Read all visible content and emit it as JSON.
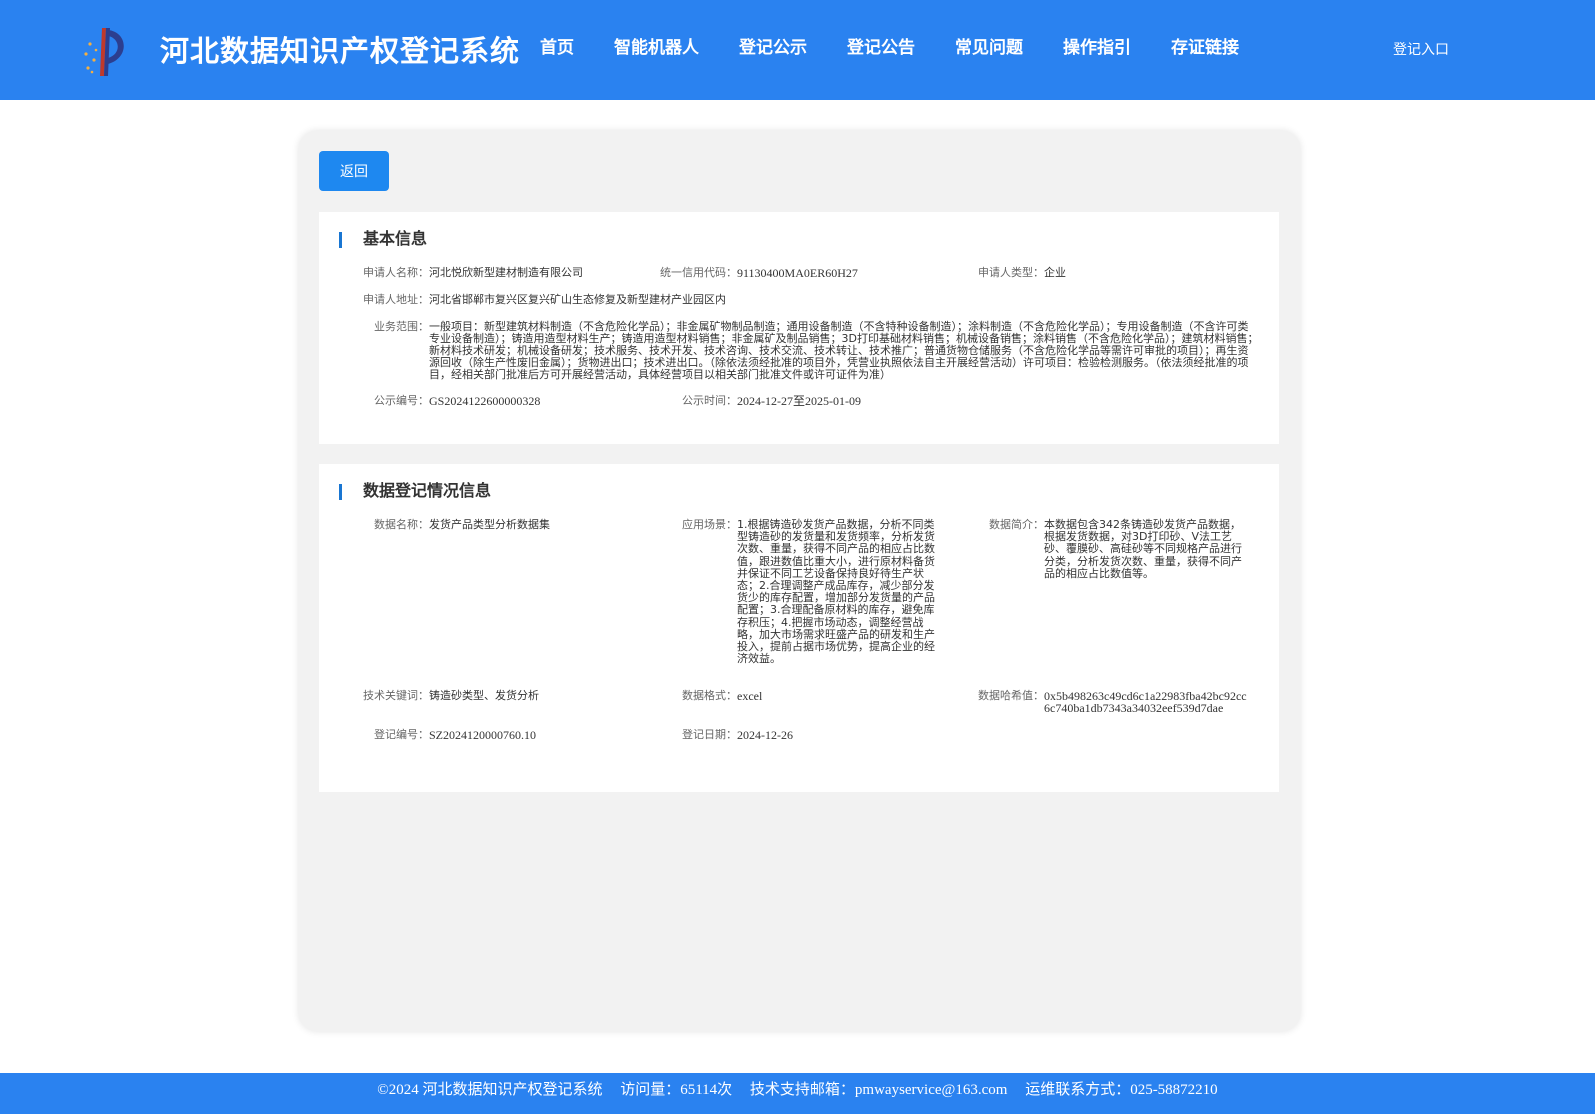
{
  "header": {
    "title": "河北数据知识产权登记系统",
    "nav": [
      "首页",
      "智能机器人",
      "登记公示",
      "登记公告",
      "常见问题",
      "操作指引",
      "存证链接"
    ],
    "login": "登记入口"
  },
  "back_button": "返回",
  "basic_info": {
    "title": "基本信息",
    "applicant_name_label": "申请人名称：",
    "applicant_name": "河北悦欣新型建材制造有限公司",
    "credit_code_label": "统一信用代码：",
    "credit_code": "91130400MA0ER60H27",
    "applicant_type_label": "申请人类型：",
    "applicant_type": "企业",
    "address_label": "申请人地址：",
    "address": "河北省邯郸市复兴区复兴矿山生态修复及新型建材产业园区内",
    "scope_label": "业务范围：",
    "scope": "一般项目：新型建筑材料制造（不含危险化学品）；非金属矿物制品制造；通用设备制造（不含特种设备制造）；涂料制造（不含危险化学品）；专用设备制造（不含许可类专业设备制造）；铸造用造型材料生产；铸造用造型材料销售；非金属矿及制品销售；3D打印基础材料销售；机械设备销售；涂料销售（不含危险化学品）；建筑材料销售；新材料技术研发；机械设备研发；技术服务、技术开发、技术咨询、技术交流、技术转让、技术推广；普通货物仓储服务（不含危险化学品等需许可审批的项目）；再生资源回收（除生产性废旧金属）；货物进出口；技术进出口。（除依法须经批准的项目外，凭营业执照依法自主开展经营活动）许可项目：检验检测服务。（依法须经批准的项目，经相关部门批准后方可开展经营活动，具体经营项目以相关部门批准文件或许可证件为准）",
    "pub_no_label": "公示编号：",
    "pub_no": "GS2024122600000328",
    "pub_time_label": "公示时间：",
    "pub_time": "2024-12-27至2025-01-09"
  },
  "data_info": {
    "title": "数据登记情况信息",
    "name_label": "数据名称：",
    "name": "发货产品类型分析数据集",
    "scenario_label": "应用场景：",
    "scenario": "1.根据铸造砂发货产品数据，分析不同类型铸造砂的发货量和发货频率，分析发货次数、重量，获得不同产品的相应占比数值，跟进数值比重大小，进行原材料备货并保证不同工艺设备保持良好待生产状态；2.合理调整产成品库存，减少部分发货少的库存配置，增加部分发货量的产品配置；3.合理配备原材料的库存，避免库存积压；4.把握市场动态，调整经营战略，加大市场需求旺盛产品的研发和生产投入，提前占据市场优势，提高企业的经济效益。",
    "intro_label": "数据简介：",
    "intro": "本数据包含342条铸造砂发货产品数据，根据发货数据，对3D打印砂、V法工艺砂、覆膜砂、高硅砂等不同规格产品进行分类，分析发货次数、重量，获得不同产品的相应占比数值等。",
    "keywords_label": "技术关键词：",
    "keywords": "铸造砂类型、发货分析",
    "format_label": "数据格式：",
    "format": "excel",
    "hash_label": "数据哈希值：",
    "hash": "0x5b498263c49cd6c1a22983fba42bc92cc6c740ba1db7343a34032eef539d7dae",
    "reg_no_label": "登记编号：",
    "reg_no": "SZ2024120000760.10",
    "reg_date_label": "登记日期：",
    "reg_date": "2024-12-26"
  },
  "footer": {
    "copyright": "©2024 河北数据知识产权登记系统",
    "visits": "访问量：65114次",
    "email": "技术支持邮箱：pmwayservice@163.com",
    "phone": "运维联系方式：025-58872210"
  },
  "colors": {
    "brand_blue": "#2a82f0",
    "button_blue": "#1e88f0",
    "section_accent": "#1976d2"
  }
}
